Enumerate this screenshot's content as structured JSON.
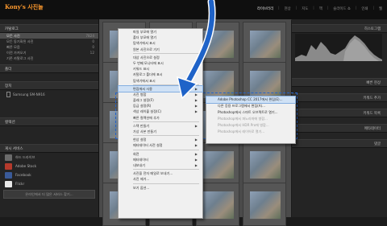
{
  "brand": "Kony's 사진놀",
  "modules": [
    "라이브러리",
    "현상",
    "지도",
    "책",
    "슬라이드 쇼",
    "인쇄",
    "웹"
  ],
  "left": {
    "catalog_header": "카탈로그",
    "catalog_items": [
      {
        "label": "모든 사진",
        "count": "7824"
      },
      {
        "label": "모든 동기화된 사진",
        "count": "0"
      },
      {
        "label": "빠른 모음",
        "count": "0"
      },
      {
        "label": "이전 가져오기",
        "count": "12"
      },
      {
        "label": "기존 카탈로그 사진",
        "count": ""
      }
    ],
    "folders_header": "폴더",
    "device_header": "장치",
    "device_item": "Samsung SM-N916",
    "collections_header": "컬렉션",
    "publish_header": "게시 서비스",
    "publish_items": [
      "하드 드라이브",
      "Adobe Stock",
      "Facebook",
      "Flickr"
    ],
    "find_more": "온라인에서 더 많은 서비스 찾기..."
  },
  "right": {
    "histogram_label": "히스토그램",
    "panels": [
      "빠른 현상",
      "키워드 추가",
      "키워드 목록",
      "메타데이터",
      "댓글"
    ]
  },
  "menu": {
    "items": [
      {
        "label": "파일 부모에 열기",
        "arrow": false,
        "dis": false
      },
      {
        "label": "폴더 부모에 열기",
        "arrow": false,
        "dis": false
      },
      {
        "label": "탐색기에서 표시",
        "arrow": false,
        "dis": false
      },
      {
        "label": "원본 사진으로 가기",
        "arrow": false,
        "dis": false
      },
      {
        "sep": true
      },
      {
        "label": "대상 사진으로 설정",
        "arrow": false,
        "dis": false
      },
      {
        "label": "두 번째 모니터에 표시",
        "arrow": false,
        "dis": false
      },
      {
        "label": "키워드 표시",
        "arrow": false,
        "dis": false
      },
      {
        "label": "카탈로그 폴더에 표시",
        "arrow": false,
        "dis": false
      },
      {
        "label": "탐색기에서 표시",
        "arrow": false,
        "dis": false
      },
      {
        "sep": true
      },
      {
        "label": "편집에서 사용",
        "arrow": true,
        "dis": false,
        "hl": true
      },
      {
        "label": "사진 병합",
        "arrow": true,
        "dis": false
      },
      {
        "label": "플래그 설정(F)",
        "arrow": true,
        "dis": false
      },
      {
        "label": "등급 설정(R)",
        "arrow": true,
        "dis": false
      },
      {
        "label": "색상 레이블 설정(C)",
        "arrow": true,
        "dis": false
      },
      {
        "label": "빠른 컬렉션에 추가",
        "arrow": false,
        "dis": false
      },
      {
        "sep": true
      },
      {
        "label": "스택 만들기",
        "arrow": true,
        "dis": false
      },
      {
        "label": "가상 사본 만들기",
        "arrow": false,
        "dis": false
      },
      {
        "sep": true
      },
      {
        "label": "현상 설정",
        "arrow": true,
        "dis": false
      },
      {
        "label": "메타데이터 사전 설정",
        "arrow": true,
        "dis": false
      },
      {
        "sep": true
      },
      {
        "label": "회전",
        "arrow": true,
        "dis": false
      },
      {
        "label": "메타데이터",
        "arrow": true,
        "dis": false
      },
      {
        "label": "내보내기",
        "arrow": true,
        "dis": false
      },
      {
        "sep": true
      },
      {
        "label": "사진을 전자 메일로 보내기...",
        "arrow": false,
        "dis": false
      },
      {
        "label": "사진 제거...",
        "arrow": false,
        "dis": false
      },
      {
        "sep": true
      },
      {
        "label": "보기 옵션...",
        "arrow": false,
        "dis": false
      }
    ]
  },
  "submenu": {
    "items": [
      {
        "label": "Adobe Photoshop CC 2017에서 편집(E)...",
        "dis": false,
        "hl": true
      },
      {
        "label": "다른 응용 프로그램에서 편집(A)...",
        "dis": false
      },
      {
        "label": "Photoshop에서 스마트 오브젝트로 열기...",
        "dis": false
      },
      {
        "label": "Photoshop에서 파노라마에 병합...",
        "dis": true
      },
      {
        "label": "Photoshop에서 HDR Pro에 병합...",
        "dis": true
      },
      {
        "label": "Photoshop에서 레이어로 열기...",
        "dis": true
      }
    ]
  }
}
